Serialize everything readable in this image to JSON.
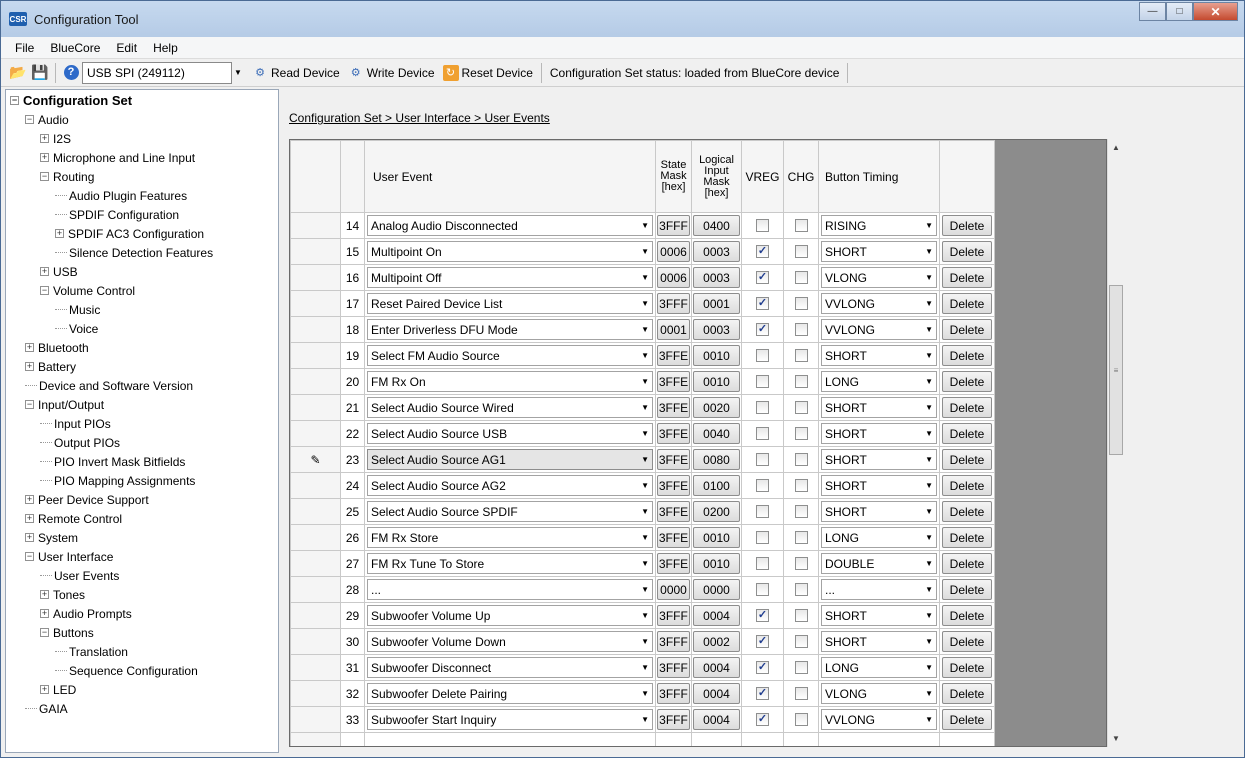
{
  "window": {
    "title": "Configuration Tool",
    "icon_text": "CSR"
  },
  "menu": [
    "File",
    "BlueCore",
    "Edit",
    "Help"
  ],
  "toolbar": {
    "device_combo": "USB SPI (249112)",
    "read_device": "Read Device",
    "write_device": "Write Device",
    "reset_device": "Reset Device",
    "status": "Configuration Set status:  loaded from BlueCore device"
  },
  "tree": [
    {
      "label": "Configuration Set",
      "level": 0,
      "box": "⊟",
      "bold": true
    },
    {
      "label": "Audio",
      "level": 1,
      "box": "⊟"
    },
    {
      "label": "I2S",
      "level": 2,
      "box": "⊞"
    },
    {
      "label": "Microphone and Line Input",
      "level": 2,
      "box": "⊞"
    },
    {
      "label": "Routing",
      "level": 2,
      "box": "⊟"
    },
    {
      "label": "Audio Plugin Features",
      "level": 3,
      "box": ""
    },
    {
      "label": "SPDIF Configuration",
      "level": 3,
      "box": ""
    },
    {
      "label": "SPDIF AC3 Configuration",
      "level": 3,
      "box": "⊞"
    },
    {
      "label": "Silence Detection Features",
      "level": 3,
      "box": ""
    },
    {
      "label": "USB",
      "level": 2,
      "box": "⊞"
    },
    {
      "label": "Volume Control",
      "level": 2,
      "box": "⊟"
    },
    {
      "label": "Music",
      "level": 3,
      "box": ""
    },
    {
      "label": "Voice",
      "level": 3,
      "box": ""
    },
    {
      "label": "Bluetooth",
      "level": 1,
      "box": "⊞"
    },
    {
      "label": "Battery",
      "level": 1,
      "box": "⊞"
    },
    {
      "label": "Device and Software Version",
      "level": 1,
      "box": ""
    },
    {
      "label": "Input/Output",
      "level": 1,
      "box": "⊟"
    },
    {
      "label": "Input PIOs",
      "level": 2,
      "box": ""
    },
    {
      "label": "Output PIOs",
      "level": 2,
      "box": ""
    },
    {
      "label": "PIO Invert Mask Bitfields",
      "level": 2,
      "box": ""
    },
    {
      "label": "PIO Mapping Assignments",
      "level": 2,
      "box": ""
    },
    {
      "label": "Peer Device Support",
      "level": 1,
      "box": "⊞"
    },
    {
      "label": "Remote Control",
      "level": 1,
      "box": "⊞"
    },
    {
      "label": "System",
      "level": 1,
      "box": "⊞"
    },
    {
      "label": "User Interface",
      "level": 1,
      "box": "⊟"
    },
    {
      "label": "User Events",
      "level": 2,
      "box": ""
    },
    {
      "label": "Tones",
      "level": 2,
      "box": "⊞"
    },
    {
      "label": "Audio Prompts",
      "level": 2,
      "box": "⊞"
    },
    {
      "label": "Buttons",
      "level": 2,
      "box": "⊟"
    },
    {
      "label": "Translation",
      "level": 3,
      "box": ""
    },
    {
      "label": "Sequence Configuration",
      "level": 3,
      "box": ""
    },
    {
      "label": "LED",
      "level": 2,
      "box": "⊞"
    },
    {
      "label": "GAIA",
      "level": 1,
      "box": ""
    }
  ],
  "breadcrumb": "Configuration Set > User Interface > User Events",
  "columns": {
    "user_event": "User Event",
    "state_mask": [
      "State",
      "Mask",
      "[hex]"
    ],
    "logical_mask": [
      "Logical",
      "Input",
      "Mask",
      "[hex]"
    ],
    "vreg": "VREG",
    "chg": "CHG",
    "button_timing": "Button Timing"
  },
  "delete_label": "Delete",
  "rows": [
    {
      "n": "14",
      "event": "Analog Audio Disconnected",
      "state": "3FFF",
      "logical": "0400",
      "vreg": false,
      "chg": false,
      "timing": "RISING"
    },
    {
      "n": "15",
      "event": "Multipoint On",
      "state": "0006",
      "logical": "0003",
      "vreg": true,
      "chg": false,
      "timing": "SHORT"
    },
    {
      "n": "16",
      "event": "Multipoint Off",
      "state": "0006",
      "logical": "0003",
      "vreg": true,
      "chg": false,
      "timing": "VLONG"
    },
    {
      "n": "17",
      "event": "Reset Paired Device List",
      "state": "3FFF",
      "logical": "0001",
      "vreg": true,
      "chg": false,
      "timing": "VVLONG"
    },
    {
      "n": "18",
      "event": "Enter Driverless DFU Mode",
      "state": "0001",
      "logical": "0003",
      "vreg": true,
      "chg": false,
      "timing": "VVLONG"
    },
    {
      "n": "19",
      "event": "Select FM Audio Source",
      "state": "3FFE",
      "logical": "0010",
      "vreg": false,
      "chg": false,
      "timing": "SHORT"
    },
    {
      "n": "20",
      "event": "FM Rx On",
      "state": "3FFE",
      "logical": "0010",
      "vreg": false,
      "chg": false,
      "timing": "LONG"
    },
    {
      "n": "21",
      "event": "Select Audio Source Wired",
      "state": "3FFE",
      "logical": "0020",
      "vreg": false,
      "chg": false,
      "timing": "SHORT"
    },
    {
      "n": "22",
      "event": "Select Audio Source USB",
      "state": "3FFE",
      "logical": "0040",
      "vreg": false,
      "chg": false,
      "timing": "SHORT"
    },
    {
      "n": "23",
      "event": "Select Audio Source AG1",
      "state": "3FFE",
      "logical": "0080",
      "vreg": false,
      "chg": false,
      "timing": "SHORT",
      "editing": true
    },
    {
      "n": "24",
      "event": "Select Audio Source AG2",
      "state": "3FFE",
      "logical": "0100",
      "vreg": false,
      "chg": false,
      "timing": "SHORT"
    },
    {
      "n": "25",
      "event": "Select Audio Source SPDIF",
      "state": "3FFE",
      "logical": "0200",
      "vreg": false,
      "chg": false,
      "timing": "SHORT"
    },
    {
      "n": "26",
      "event": "FM Rx Store",
      "state": "3FFE",
      "logical": "0010",
      "vreg": false,
      "chg": false,
      "timing": "LONG"
    },
    {
      "n": "27",
      "event": "FM Rx Tune To Store",
      "state": "3FFE",
      "logical": "0010",
      "vreg": false,
      "chg": false,
      "timing": "DOUBLE"
    },
    {
      "n": "28",
      "event": "...",
      "state": "0000",
      "logical": "0000",
      "vreg": false,
      "chg": false,
      "timing": "..."
    },
    {
      "n": "29",
      "event": "Subwoofer Volume Up",
      "state": "3FFF",
      "logical": "0004",
      "vreg": true,
      "chg": false,
      "timing": "SHORT"
    },
    {
      "n": "30",
      "event": "Subwoofer Volume Down",
      "state": "3FFF",
      "logical": "0002",
      "vreg": true,
      "chg": false,
      "timing": "SHORT"
    },
    {
      "n": "31",
      "event": "Subwoofer Disconnect",
      "state": "3FFF",
      "logical": "0004",
      "vreg": true,
      "chg": false,
      "timing": "LONG"
    },
    {
      "n": "32",
      "event": "Subwoofer Delete Pairing",
      "state": "3FFF",
      "logical": "0004",
      "vreg": true,
      "chg": false,
      "timing": "VLONG"
    },
    {
      "n": "33",
      "event": "Subwoofer Start Inquiry",
      "state": "3FFF",
      "logical": "0004",
      "vreg": true,
      "chg": false,
      "timing": "VVLONG"
    }
  ]
}
